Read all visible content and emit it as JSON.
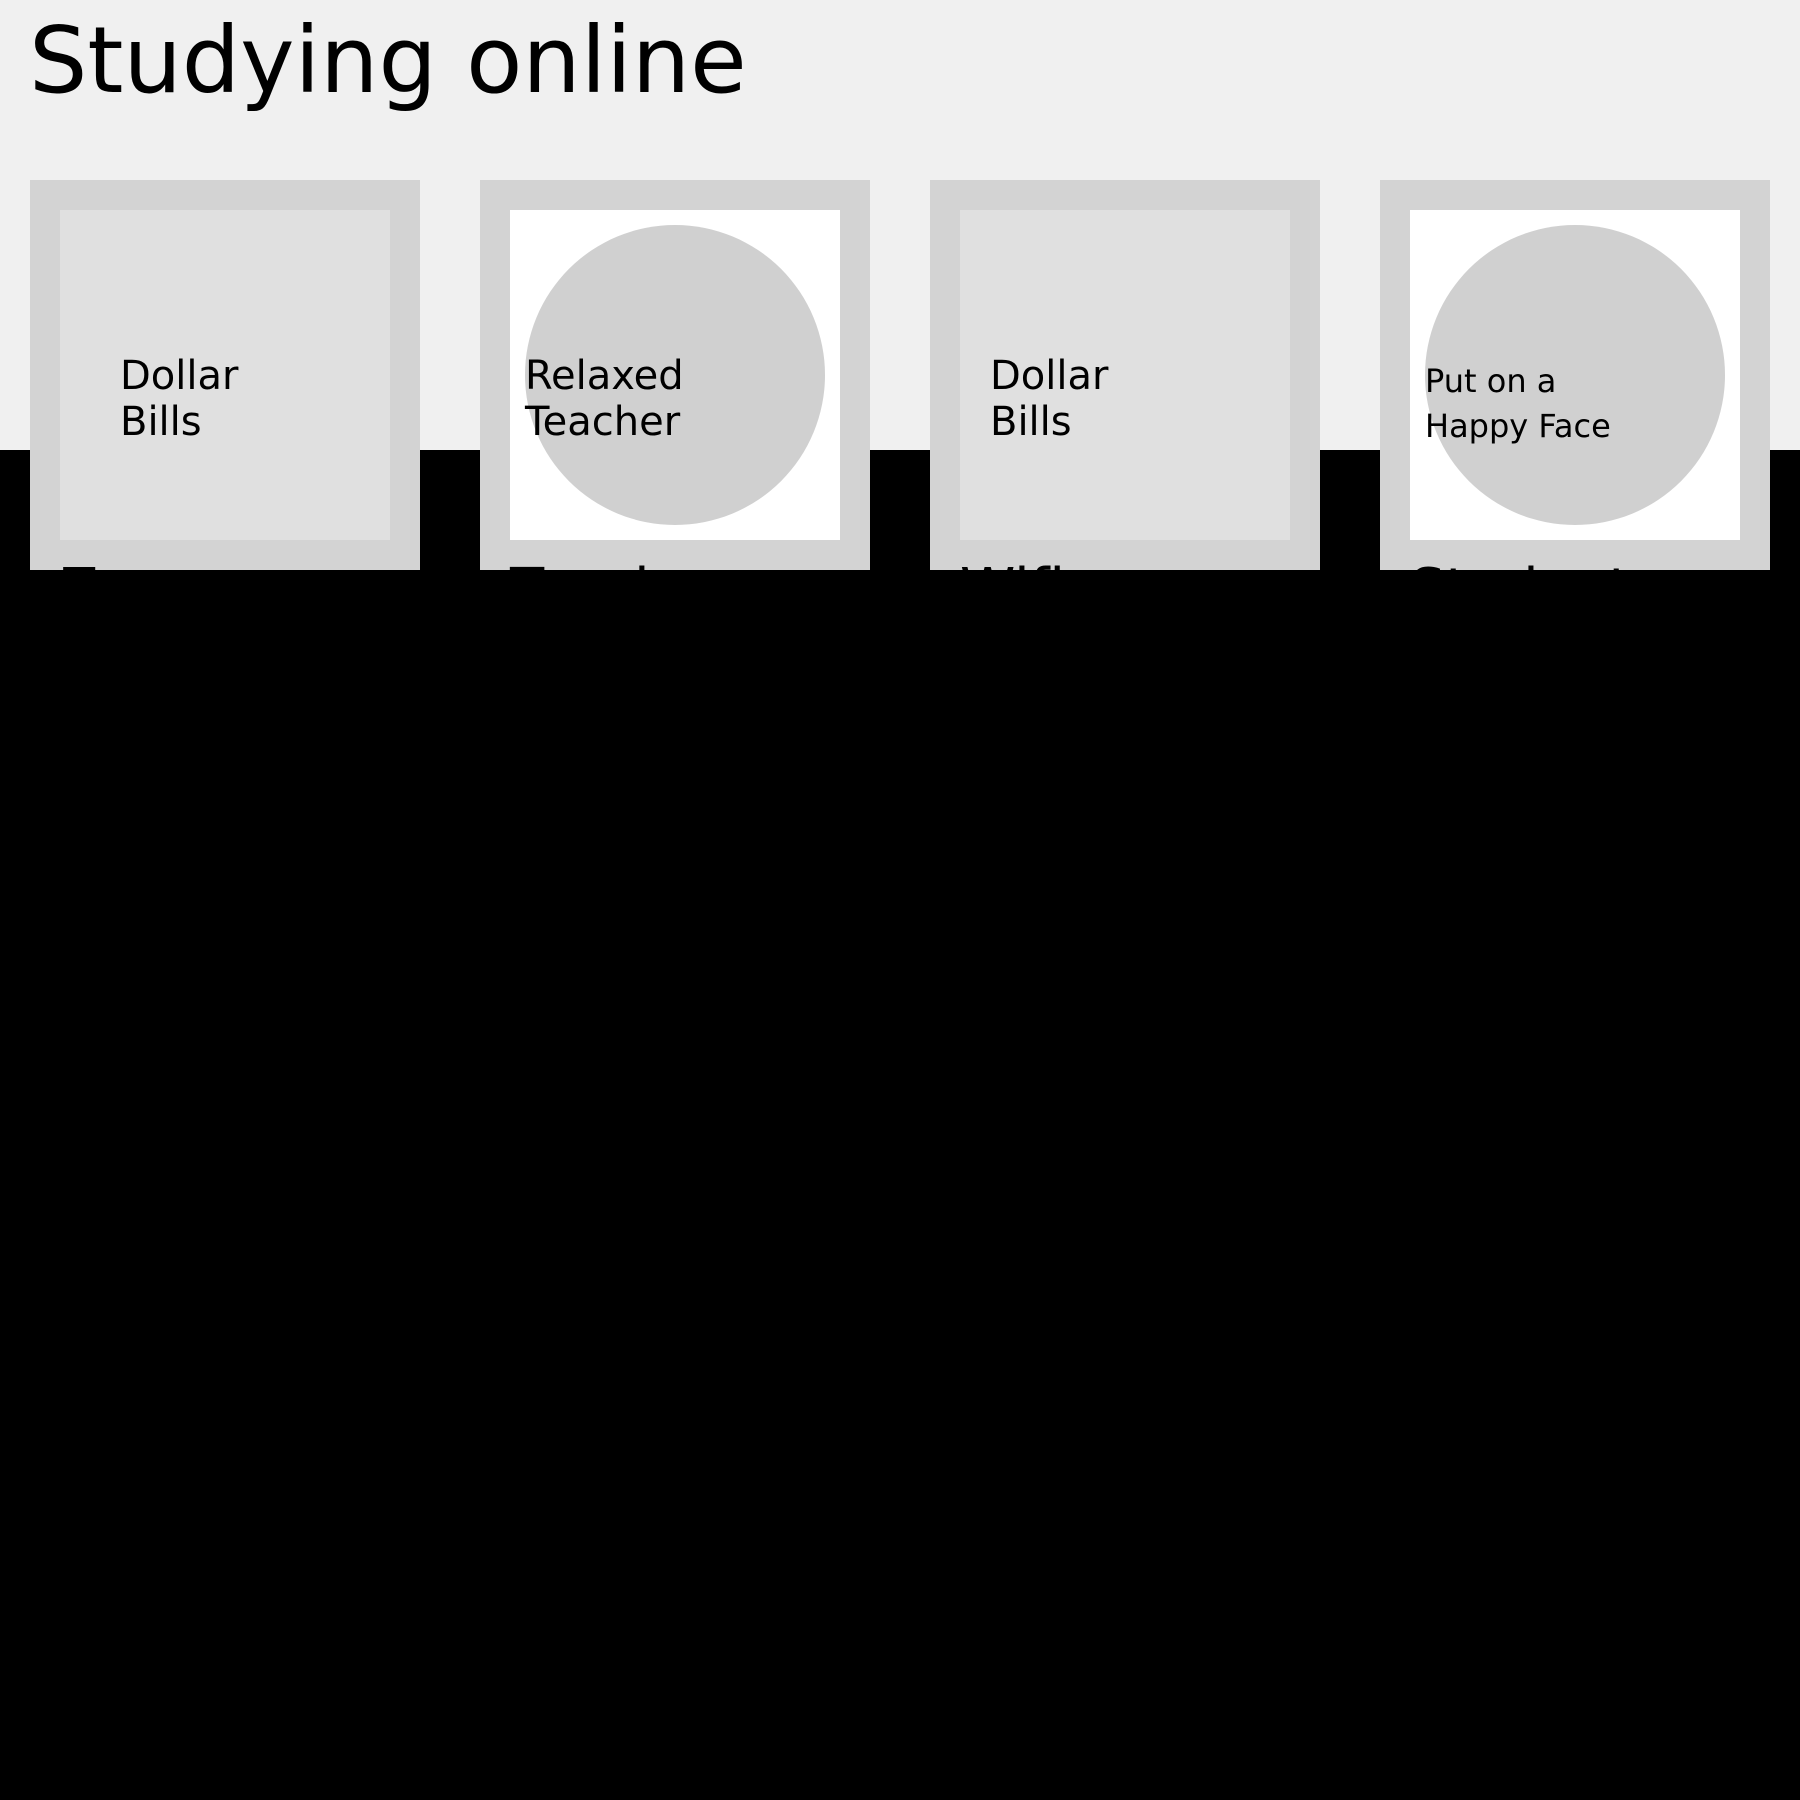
{
  "page": {
    "title": "Studying online"
  },
  "cards": [
    {
      "title": "Zoom",
      "image_text": "Dollar\nBills",
      "image_shape": "square"
    },
    {
      "title": "Teacher",
      "image_text": "Relaxed\nTeacher",
      "image_shape": "circle"
    },
    {
      "title": "Wifi company",
      "image_text": "Dollar\nBills",
      "image_shape": "square"
    },
    {
      "title": "Students",
      "image_text": "Put on a\nHappy Face",
      "image_shape": "circle"
    }
  ],
  "colors": {
    "background_top": "#f0f0f0",
    "background_bottom": "#000000",
    "card_frame": "#d3d3d3",
    "square_image": "#e0e0e0",
    "circle_frame": "#ffffff",
    "circle": "#d0d0d0"
  }
}
